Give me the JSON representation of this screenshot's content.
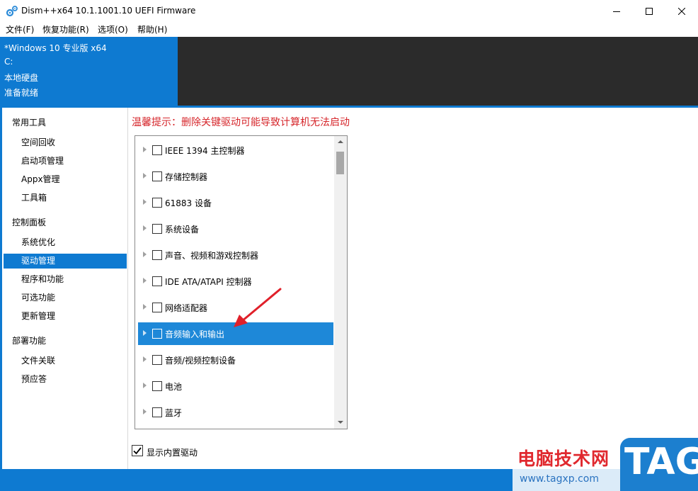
{
  "window": {
    "title": "Dism++x64 10.1.1001.10 UEFI Firmware"
  },
  "menu": [
    "文件(F)",
    "恢复功能(R)",
    "选项(O)",
    "帮助(H)"
  ],
  "info": {
    "os": "*Windows 10 专业版 x64",
    "drive": "C:",
    "disk": "本地硬盘",
    "status": "准备就绪"
  },
  "sidebar": {
    "groups": [
      {
        "title": "常用工具",
        "items": [
          "空间回收",
          "启动项管理",
          "Appx管理",
          "工具箱"
        ]
      },
      {
        "title": "控制面板",
        "items": [
          "系统优化",
          "驱动管理",
          "程序和功能",
          "可选功能",
          "更新管理"
        ]
      },
      {
        "title": "部署功能",
        "items": [
          "文件关联",
          "预应答"
        ]
      }
    ],
    "active_item": "驱动管理"
  },
  "content": {
    "warning": "温馨提示：删除关键驱动可能导致计算机无法启动",
    "device_categories": [
      "IEEE 1394 主控制器",
      "存储控制器",
      "61883 设备",
      "系统设备",
      "声音、视频和游戏控制器",
      "IDE ATA/ATAPI 控制器",
      "网络适配器",
      "音频输入和输出",
      "音频/视频控制设备",
      "电池",
      "蓝牙"
    ],
    "selected_category": "音频输入和输出",
    "show_builtin_label": "显示内置驱动",
    "show_builtin_checked": true
  },
  "watermark": {
    "title": "电脑技术网",
    "url": "www.tagxp.com",
    "tag": "TAG"
  },
  "colors": {
    "accent": "#0e7ad1",
    "selected_row": "#1e88d8",
    "warning": "#d6262b",
    "header_dark": "#2b2b2b"
  }
}
